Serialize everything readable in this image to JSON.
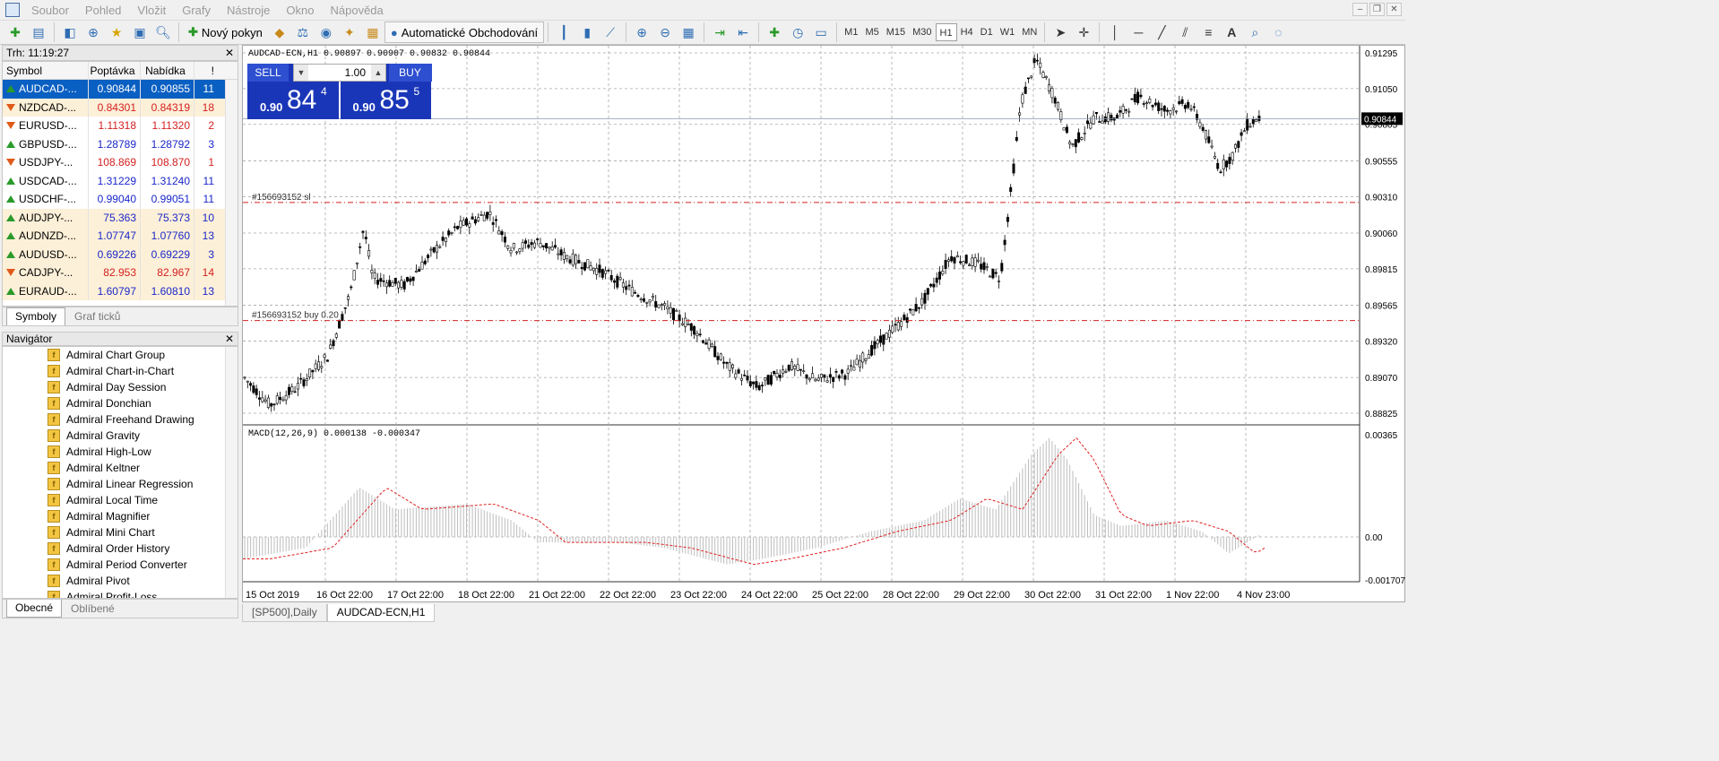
{
  "menu": [
    "Soubor",
    "Pohled",
    "Vložit",
    "Grafy",
    "Nástroje",
    "Okno",
    "Nápověda"
  ],
  "toolbar": {
    "new_order": "Nový pokyn",
    "autotrading": "Automatické Obchodování",
    "timeframes": [
      "M1",
      "M5",
      "M15",
      "M30",
      "H1",
      "H4",
      "D1",
      "W1",
      "MN"
    ],
    "active_timeframe": "H1"
  },
  "market_watch": {
    "title": "Trh: 11:19:27",
    "columns": [
      "Symbol",
      "Poptávka",
      "Nabídka",
      "!"
    ],
    "rows": [
      {
        "symbol": "AUDCAD-...",
        "bid": "0.90844",
        "ask": "0.90855",
        "spread": "11",
        "dir": "up",
        "state": "sel"
      },
      {
        "symbol": "NZDCAD-...",
        "bid": "0.84301",
        "ask": "0.84319",
        "spread": "18",
        "dir": "down",
        "state": "peach"
      },
      {
        "symbol": "EURUSD-...",
        "bid": "1.11318",
        "ask": "1.11320",
        "spread": "2",
        "dir": "down",
        "state": ""
      },
      {
        "symbol": "GBPUSD-...",
        "bid": "1.28789",
        "ask": "1.28792",
        "spread": "3",
        "dir": "up",
        "state": ""
      },
      {
        "symbol": "USDJPY-...",
        "bid": "108.869",
        "ask": "108.870",
        "spread": "1",
        "dir": "down",
        "state": ""
      },
      {
        "symbol": "USDCAD-...",
        "bid": "1.31229",
        "ask": "1.31240",
        "spread": "11",
        "dir": "up",
        "state": ""
      },
      {
        "symbol": "USDCHF-...",
        "bid": "0.99040",
        "ask": "0.99051",
        "spread": "11",
        "dir": "up",
        "state": ""
      },
      {
        "symbol": "AUDJPY-...",
        "bid": "75.363",
        "ask": "75.373",
        "spread": "10",
        "dir": "up",
        "state": "peach"
      },
      {
        "symbol": "AUDNZD-...",
        "bid": "1.07747",
        "ask": "1.07760",
        "spread": "13",
        "dir": "up",
        "state": "peach"
      },
      {
        "symbol": "AUDUSD-...",
        "bid": "0.69226",
        "ask": "0.69229",
        "spread": "3",
        "dir": "up",
        "state": "peach"
      },
      {
        "symbol": "CADJPY-...",
        "bid": "82.953",
        "ask": "82.967",
        "spread": "14",
        "dir": "down",
        "state": "peach"
      },
      {
        "symbol": "EURAUD-...",
        "bid": "1.60797",
        "ask": "1.60810",
        "spread": "13",
        "dir": "up",
        "state": "peach"
      }
    ],
    "tabs": [
      "Symboly",
      "Graf ticků"
    ]
  },
  "navigator": {
    "title": "Navigátor",
    "items": [
      "Admiral Chart Group",
      "Admiral Chart-in-Chart",
      "Admiral Day Session",
      "Admiral Donchian",
      "Admiral Freehand Drawing",
      "Admiral Gravity",
      "Admiral High-Low",
      "Admiral Keltner",
      "Admiral Linear Regression",
      "Admiral Local Time",
      "Admiral Magnifier",
      "Admiral Mini Chart",
      "Admiral Order History",
      "Admiral Period Converter",
      "Admiral Pivot",
      "Admiral Profit-Loss"
    ],
    "tabs": [
      "Obecné",
      "Oblíbené"
    ]
  },
  "chart": {
    "header": "AUDCAD-ECN,H1  0.90897 0.90907 0.90832 0.90844",
    "one_click": {
      "sell_label": "SELL",
      "buy_label": "BUY",
      "lot": "1.00",
      "sell_small": "0.90",
      "sell_big": "84",
      "sell_sup": "4",
      "buy_small": "0.90",
      "buy_big": "85",
      "buy_sup": "5"
    },
    "order_lines": [
      {
        "label": "#156693152 sl",
        "price": 0.9027
      },
      {
        "label": "#156693152 buy 0.20",
        "price": 0.8946
      }
    ],
    "price_axis": [
      "0.91295",
      "0.91050",
      "0.90805",
      "0.90555",
      "0.90310",
      "0.90060",
      "0.89815",
      "0.89565",
      "0.89320",
      "0.89070",
      "0.88825"
    ],
    "current_price": "0.90844",
    "macd_label": "MACD(12,26,9) 0.000138 -0.000347",
    "macd_axis": [
      "0.00365",
      "0.00",
      "-0.001707"
    ],
    "time_axis": [
      "15 Oct 2019",
      "16 Oct 22:00",
      "17 Oct 22:00",
      "18 Oct 22:00",
      "21 Oct 22:00",
      "22 Oct 22:00",
      "23 Oct 22:00",
      "24 Oct 22:00",
      "25 Oct 22:00",
      "28 Oct 22:00",
      "29 Oct 22:00",
      "30 Oct 22:00",
      "31 Oct 22:00",
      "1 Nov 22:00",
      "4 Nov 23:00"
    ],
    "colors": {
      "bull_bear": "#000000",
      "order_line": "#d42020",
      "signal": "#e02020",
      "histogram": "#bdbdbd",
      "grid": "#a8a8a8"
    }
  },
  "chart_tabs": [
    "[SP500],Daily",
    "AUDCAD-ECN,H1"
  ]
}
